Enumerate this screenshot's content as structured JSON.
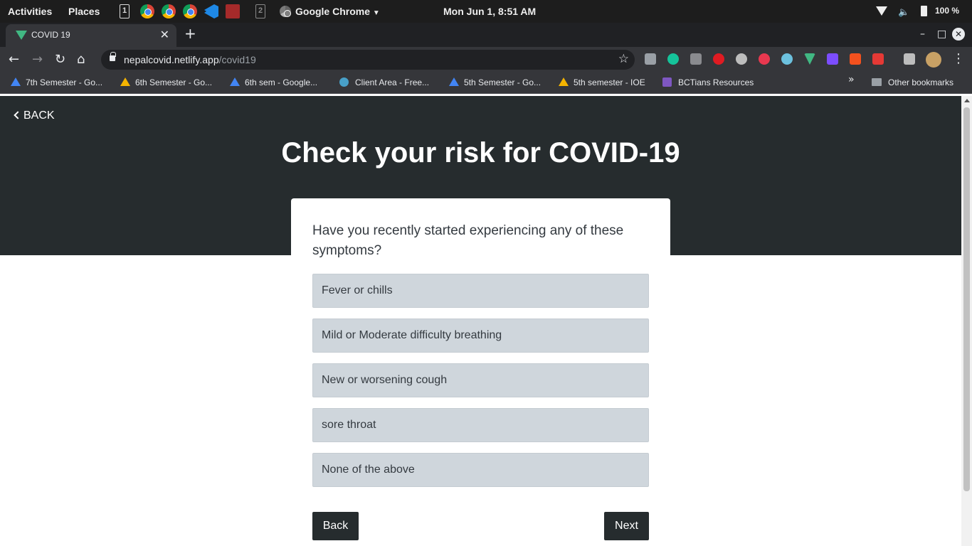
{
  "system": {
    "activities": "Activities",
    "places": "Places",
    "workspace1": "1",
    "workspace2": "2",
    "app_name": "Google Chrome",
    "clock": "Mon Jun  1,  8:51 AM",
    "battery": "100 %"
  },
  "browser": {
    "tab_title": "COVID 19",
    "url_host": "nepalcovid.netlify.app",
    "url_path": "/covid19",
    "bookmarks": [
      "7th Semester - Go...",
      "6th Semester - Go...",
      "6th sem - Google...",
      "Client Area - Free...",
      "5th Semester - Go...",
      "5th semester - IOE",
      "BCTians Resources"
    ],
    "other_bookmarks": "Other bookmarks"
  },
  "page": {
    "back_link": "BACK",
    "title": "Check your risk for COVID-19",
    "question": "Have you recently started experiencing any of these symptoms?",
    "options": [
      "Fever or chills",
      "Mild or Moderate difficulty breathing",
      "New or worsening cough",
      "sore throat",
      "None of the above"
    ],
    "back_button": "Back",
    "next_button": "Next"
  }
}
